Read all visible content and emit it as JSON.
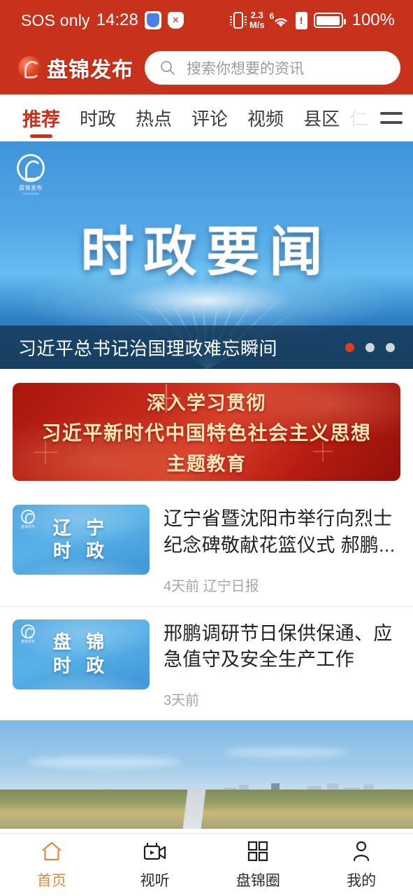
{
  "status_bar": {
    "carrier": "SOS only",
    "time": "14:28",
    "shield_icon": "shield-blue-icon",
    "shield_x_icon": "shield-x-icon",
    "vibrate_icon": "vibrate-icon",
    "net_speed_value": "2.3",
    "net_speed_unit": "M/s",
    "wifi_gen": "6",
    "wifi_icon": "wifi-icon",
    "sim_warning_icon": "sim-warning-icon",
    "battery_icon": "battery-icon",
    "battery_percent": "100%"
  },
  "header": {
    "brand_name": "盘锦发布",
    "brand_logo_icon": "panjin-logo-icon",
    "search_icon": "search-icon",
    "search_placeholder": "搜索你想要的资讯",
    "search_value": ""
  },
  "tabs": {
    "items": [
      {
        "label": "推荐",
        "active": true
      },
      {
        "label": "时政",
        "active": false
      },
      {
        "label": "热点",
        "active": false
      },
      {
        "label": "评论",
        "active": false
      },
      {
        "label": "视频",
        "active": false
      },
      {
        "label": "县区",
        "active": false
      },
      {
        "label": "仁",
        "active": false
      }
    ],
    "menu_icon": "hamburger-menu-icon"
  },
  "carousel": {
    "slide_title": "时政要闻",
    "caption": "习近平总书记治国理政难忘瞬间",
    "watermark_name": "盘锦发布",
    "watermark_sub": "PANJINFABU",
    "dots": [
      {
        "active": true
      },
      {
        "active": false
      },
      {
        "active": false
      }
    ],
    "colors": {
      "sky_top": "#3f93da",
      "sky_mid": "#66bdf0",
      "sky_bottom": "#1d5f9e",
      "caption_bg": "rgba(22,56,84,.82)",
      "dot_active": "#e23b20",
      "dot_inactive": "#cfd6da"
    }
  },
  "promo_banner": {
    "line1": "深入学习贯彻",
    "line2": "习近平新时代中国特色社会主义思想",
    "line3": "主题教育",
    "bg_color": "#c2281a",
    "text_color": "#ffe6b8"
  },
  "news_list": [
    {
      "thumb_line1": "辽 宁",
      "thumb_line2": "时 政",
      "thumb_watermark": "盘锦发布",
      "title": "辽宁省暨沈阳市举行向烈士纪念碑敬献花篮仪式  郝鹏...",
      "meta": "4天前 辽宁日报"
    },
    {
      "thumb_line1": "盘 锦",
      "thumb_line2": "时 政",
      "thumb_watermark": "盘锦发布",
      "title": "邢鹏调研节日保供保通、应急值守及安全生产工作",
      "meta": "3天前"
    }
  ],
  "city_photo": {
    "alt": "盘锦城市全景"
  },
  "bottom_nav": {
    "items": [
      {
        "label": "首页",
        "icon": "home-icon",
        "active": true
      },
      {
        "label": "视听",
        "icon": "video-camera-icon",
        "active": false
      },
      {
        "label": "盘锦圈",
        "icon": "grid-icon",
        "active": false
      },
      {
        "label": "我的",
        "icon": "person-icon",
        "active": false
      }
    ],
    "active_color": "#d98b3f",
    "inactive_color": "#2b2b2b"
  },
  "theme": {
    "brand_red": "#c8311c",
    "accent_orange": "#d98b3f",
    "page_bg": "#f2f2f2"
  }
}
